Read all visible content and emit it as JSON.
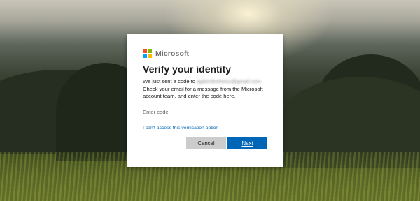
{
  "brand": {
    "name": "Microsoft",
    "logo_colors": [
      "#f25022",
      "#7fba00",
      "#00a4ef",
      "#ffb900"
    ]
  },
  "dialog": {
    "title": "Verify your identity",
    "description_prefix": "We just sent a code to",
    "masked_email": "agiterdtrehetur@gmail.com",
    "description_suffix": "Check your email for a message from the Microsoft account team, and enter the code here.",
    "code_placeholder": "Enter code",
    "code_value": "",
    "alt_link": "I can't access this verification option",
    "cancel_label": "Cancel",
    "next_label": "Next"
  },
  "colors": {
    "accent": "#0067b8",
    "secondary_button": "#cccccc"
  }
}
